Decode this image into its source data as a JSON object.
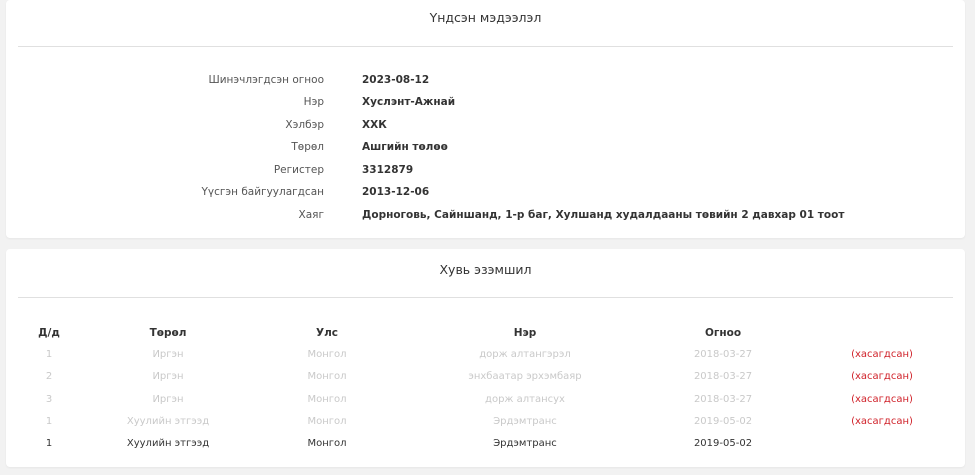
{
  "basic_info": {
    "title": "Үндсэн мэдээлэл",
    "rows": [
      {
        "label": "Шинэчлэгдсэн огноо",
        "value": "2023-08-12"
      },
      {
        "label": "Нэр",
        "value": "Хуслэнт-Ажнай"
      },
      {
        "label": "Хэлбэр",
        "value": "ХХК"
      },
      {
        "label": "Төрөл",
        "value": "Ашгийн төлөө"
      },
      {
        "label": "Регистер",
        "value": "3312879"
      },
      {
        "label": "Үүсгэн байгуулагдсан",
        "value": "2013-12-06"
      },
      {
        "label": "Хаяг",
        "value": "Дорноговь, Сайншанд, 1-р баг, Хулшанд худалдааны төвийн 2 давхар 01 тоот"
      }
    ]
  },
  "shareholders": {
    "title": "Хувь эзэмшил",
    "headers": {
      "num": "Д/д",
      "type": "Төрөл",
      "country": "Улс",
      "name": "Нэр",
      "date": "Огноо"
    },
    "rows": [
      {
        "num": "1",
        "type": "Иргэн",
        "country": "Монгол",
        "name": "дорж алтангэрэл",
        "date": "2018-03-27",
        "status": "(хасагдсан)"
      },
      {
        "num": "2",
        "type": "Иргэн",
        "country": "Монгол",
        "name": "энхбаатар эрхэмбаяр",
        "date": "2018-03-27",
        "status": "(хасагдсан)"
      },
      {
        "num": "3",
        "type": "Иргэн",
        "country": "Монгол",
        "name": "дорж алтансух",
        "date": "2018-03-27",
        "status": "(хасагдсан)"
      },
      {
        "num": "1",
        "type": "Хуулийн этгээд",
        "country": "Монгол",
        "name": "Эрдэмтранс",
        "date": "2019-05-02",
        "status": "(хасагдсан)"
      },
      {
        "num": "1",
        "type": "Хуулийн этгээд",
        "country": "Монгол",
        "name": "Эрдэмтранс",
        "date": "2019-05-02",
        "status": ""
      }
    ]
  },
  "colors": {
    "removed": "#d0222a",
    "muted_text": "#c9c9c9",
    "background": "#f2f2f2"
  }
}
